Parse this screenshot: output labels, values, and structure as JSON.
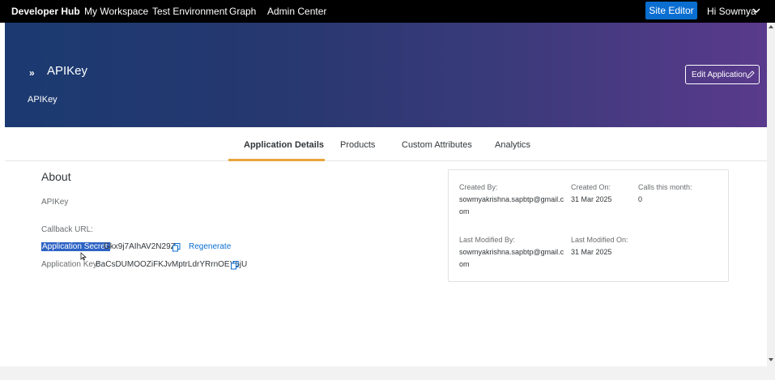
{
  "topnav": {
    "brand": "Developer Hub",
    "items": [
      "My Workspace",
      "Test Environment",
      "Graph",
      "Admin Center"
    ],
    "site_editor": "Site Editor",
    "user": "Hi Sowmya"
  },
  "hero": {
    "title": "APIKey",
    "subtitle": "APIKey",
    "edit_button": "Edit Application"
  },
  "tabs": [
    "Application Details",
    "Products",
    "Custom Attributes",
    "Analytics"
  ],
  "about": {
    "title": "About",
    "description": "APIKey",
    "callback_label": "Callback URL:",
    "secret_label": "Application Secret:",
    "secret_value": "Gkx9j7AIhAV2N29Z",
    "regenerate": "Regenerate",
    "key_label": "Application Key:",
    "key_value": "BaCsDUMOOZiFKJvMptrLdrYRrnOEY6jU"
  },
  "info": {
    "created_by_label": "Created By:",
    "created_by_line1": "sowmyakrishna.sapbtp@gmail.c",
    "created_by_line2": "om",
    "created_on_label": "Created On:",
    "created_on": "31 Mar 2025",
    "calls_label": "Calls this month:",
    "calls": "0",
    "modified_by_label": "Last Modified By:",
    "modified_by_line1": "sowmyakrishna.sapbtp@gmail.c",
    "modified_by_line2": "om",
    "modified_on_label": "Last Modified On:",
    "modified_on": "31 Mar 2025"
  },
  "colors": {
    "accent": "#0a6ed1",
    "tab_underline": "#e9a43a",
    "hero_start": "#1b3a71",
    "hero_end": "#5a3a8c"
  }
}
